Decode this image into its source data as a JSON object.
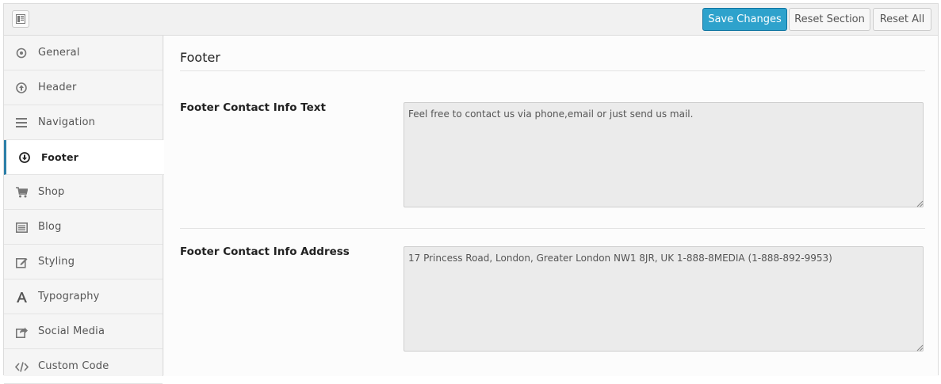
{
  "toolbar": {
    "save_label": "Save Changes",
    "reset_section_label": "Reset Section",
    "reset_all_label": "Reset All"
  },
  "sidebar": {
    "items": [
      {
        "label": "General",
        "icon": "circle-dot-icon",
        "active": false
      },
      {
        "label": "Header",
        "icon": "arrow-up-circle-icon",
        "active": false
      },
      {
        "label": "Navigation",
        "icon": "menu-icon",
        "active": false
      },
      {
        "label": "Footer",
        "icon": "arrow-down-circle-icon",
        "active": true
      },
      {
        "label": "Shop",
        "icon": "cart-icon",
        "active": false
      },
      {
        "label": "Blog",
        "icon": "list-icon",
        "active": false
      },
      {
        "label": "Styling",
        "icon": "edit-icon",
        "active": false
      },
      {
        "label": "Typography",
        "icon": "font-icon",
        "active": false
      },
      {
        "label": "Social Media",
        "icon": "share-icon",
        "active": false
      },
      {
        "label": "Custom Code",
        "icon": "code-icon",
        "active": false
      }
    ]
  },
  "main": {
    "section_title": "Footer",
    "fields": [
      {
        "label": "Footer Contact Info Text",
        "value": "Feel free to contact us via phone,email or just send us mail."
      },
      {
        "label": "Footer Contact Info Address",
        "value": "17 Princess Road, London, Greater London NW1 8JR, UK 1-888-8MEDIA (1-888-892-9953)"
      }
    ]
  },
  "colors": {
    "primary_button": "#2ea2cc",
    "active_indicator": "#2c7fa8",
    "textarea_bg": "#ebebeb"
  }
}
